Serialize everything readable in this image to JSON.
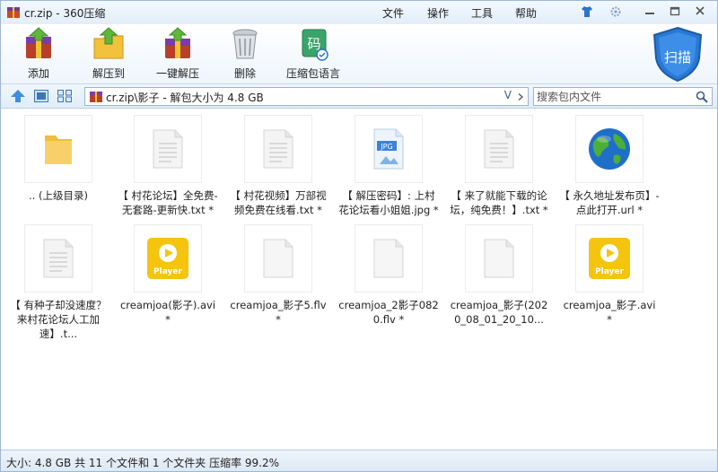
{
  "window": {
    "title": "cr.zip - 360压缩",
    "menu": [
      "文件",
      "操作",
      "工具",
      "帮助"
    ]
  },
  "toolbar": {
    "buttons": [
      {
        "label": "添加",
        "icon": "add-archive-icon"
      },
      {
        "label": "解压到",
        "icon": "extract-to-icon"
      },
      {
        "label": "一键解压",
        "icon": "one-click-extract-icon"
      },
      {
        "label": "删除",
        "icon": "trash-can-icon"
      },
      {
        "label": "压缩包语言",
        "icon": "archive-language-icon"
      }
    ],
    "scan_label": "扫描"
  },
  "nav": {
    "path": "cr.zip\\影子 - 解包大小为 4.8 GB",
    "dropdown_glyph": "V",
    "search_placeholder": "搜索包内文件"
  },
  "files": [
    {
      "name": ".. (上级目录)",
      "type": "folder"
    },
    {
      "name": "【 村花论坛】全免费-无套路-更新快.txt *",
      "type": "txt"
    },
    {
      "name": "【 村花视频】万部视频免费在线看.txt *",
      "type": "txt"
    },
    {
      "name": "【 解压密码】: 上村花论坛看小姐姐.jpg *",
      "type": "jpg"
    },
    {
      "name": "【 来了就能下载的论坛，纯免费！】.txt *",
      "type": "txt"
    },
    {
      "name": "【 永久地址发布页】-点此打开.url *",
      "type": "url"
    },
    {
      "name": "【 有种子却没速度？来村花论坛人工加速】.t...",
      "type": "txt"
    },
    {
      "name": "creamjoa(影子).avi *",
      "type": "avi"
    },
    {
      "name": "creamjoa_影子5.flv *",
      "type": "flv"
    },
    {
      "name": "creamjoa_2影子0820.flv *",
      "type": "flv"
    },
    {
      "name": "creamjoa_影子(2020_08_01_20_10...",
      "type": "flv"
    },
    {
      "name": "creamjoa_影子.avi *",
      "type": "avi"
    }
  ],
  "player_badge": "Player",
  "jpg_badge": "JPG",
  "status": "大小: 4.8 GB 共 11 个文件和 1 个文件夹 压缩率 99.2%",
  "colors": {
    "accent": "#2a73c9",
    "folder": "#f5c342",
    "player": "#f4c40f"
  }
}
